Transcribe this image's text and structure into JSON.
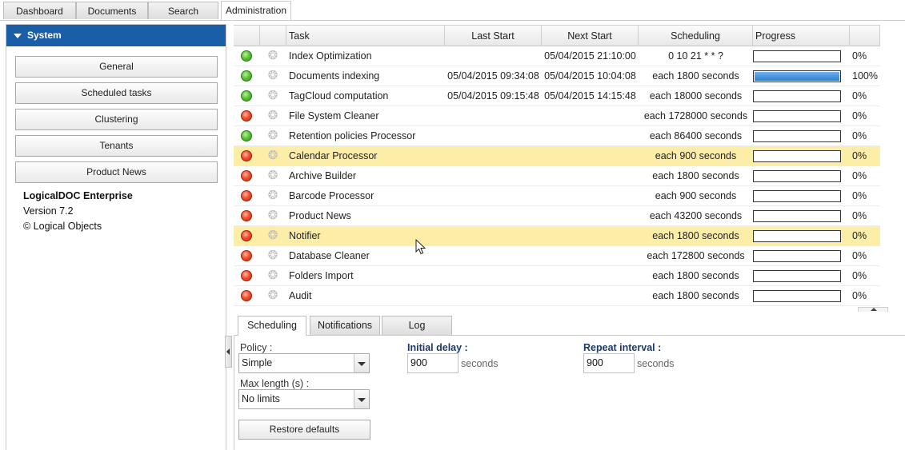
{
  "top_tabs": [
    "Dashboard",
    "Documents",
    "Search",
    "Administration"
  ],
  "left_panel": {
    "section_title": "System",
    "buttons": [
      "General",
      "Scheduled tasks",
      "Clustering",
      "Tenants",
      "Product News"
    ],
    "product_name": "LogicalDOC Enterprise",
    "version": "Version 7.2",
    "copyright": "© Logical Objects"
  },
  "grid": {
    "columns": {
      "task": "Task",
      "last_start": "Last Start",
      "next_start": "Next Start",
      "scheduling": "Scheduling",
      "progress": "Progress"
    },
    "rows": [
      {
        "status": "green",
        "task": "Index Optimization",
        "last_start": "",
        "next_start": "05/04/2015 21:10:00",
        "scheduling": "0 10 21 * * ?",
        "progress": 0,
        "progress_text": "0%",
        "selected": false
      },
      {
        "status": "green",
        "task": "Documents indexing",
        "last_start": "05/04/2015 09:34:08",
        "next_start": "05/04/2015 10:04:08",
        "scheduling": "each 1800 seconds",
        "progress": 100,
        "progress_text": "100%",
        "selected": false
      },
      {
        "status": "green",
        "task": "TagCloud computation",
        "last_start": "05/04/2015 09:15:48",
        "next_start": "05/04/2015 14:15:48",
        "scheduling": "each 18000 seconds",
        "progress": 0,
        "progress_text": "0%",
        "selected": false
      },
      {
        "status": "red",
        "task": "File System Cleaner",
        "last_start": "",
        "next_start": "",
        "scheduling": "each 1728000 seconds",
        "progress": 0,
        "progress_text": "0%",
        "selected": false
      },
      {
        "status": "green",
        "task": "Retention policies Processor",
        "last_start": "",
        "next_start": "",
        "scheduling": "each 86400 seconds",
        "progress": 0,
        "progress_text": "0%",
        "selected": false
      },
      {
        "status": "red",
        "task": "Calendar Processor",
        "last_start": "",
        "next_start": "",
        "scheduling": "each 900 seconds",
        "progress": 0,
        "progress_text": "0%",
        "selected": true
      },
      {
        "status": "red",
        "task": "Archive Builder",
        "last_start": "",
        "next_start": "",
        "scheduling": "each 1800 seconds",
        "progress": 0,
        "progress_text": "0%",
        "selected": false
      },
      {
        "status": "red",
        "task": "Barcode Processor",
        "last_start": "",
        "next_start": "",
        "scheduling": "each 900 seconds",
        "progress": 0,
        "progress_text": "0%",
        "selected": false
      },
      {
        "status": "red",
        "task": "Product News",
        "last_start": "",
        "next_start": "",
        "scheduling": "each 43200 seconds",
        "progress": 0,
        "progress_text": "0%",
        "selected": false
      },
      {
        "status": "red",
        "task": "Notifier",
        "last_start": "",
        "next_start": "",
        "scheduling": "each 1800 seconds",
        "progress": 0,
        "progress_text": "0%",
        "selected": true
      },
      {
        "status": "red",
        "task": "Database Cleaner",
        "last_start": "",
        "next_start": "",
        "scheduling": "each 172800 seconds",
        "progress": 0,
        "progress_text": "0%",
        "selected": false
      },
      {
        "status": "red",
        "task": "Folders Import",
        "last_start": "",
        "next_start": "",
        "scheduling": "each 1800 seconds",
        "progress": 0,
        "progress_text": "0%",
        "selected": false
      },
      {
        "status": "red",
        "task": "Audit",
        "last_start": "",
        "next_start": "",
        "scheduling": "each 1800 seconds",
        "progress": 0,
        "progress_text": "0%",
        "selected": false
      }
    ]
  },
  "bottom_tabs": [
    "Scheduling",
    "Notifications",
    "Log"
  ],
  "form": {
    "policy_label": "Policy :",
    "policy_value": "Simple",
    "max_length_label": "Max length (s) :",
    "max_length_value": "No limits",
    "initial_delay_label": "Initial delay :",
    "initial_delay_value": "900",
    "initial_delay_unit": "seconds",
    "repeat_interval_label": "Repeat interval :",
    "repeat_interval_value": "900",
    "repeat_interval_unit": "seconds",
    "restore_label": "Restore defaults"
  },
  "colors": {
    "header_blue": "#1a5ea8",
    "selection": "#fdeea7",
    "status_green": "#5ec43b",
    "status_red": "#f2502e",
    "progress_blue": "#2f7fd0"
  }
}
